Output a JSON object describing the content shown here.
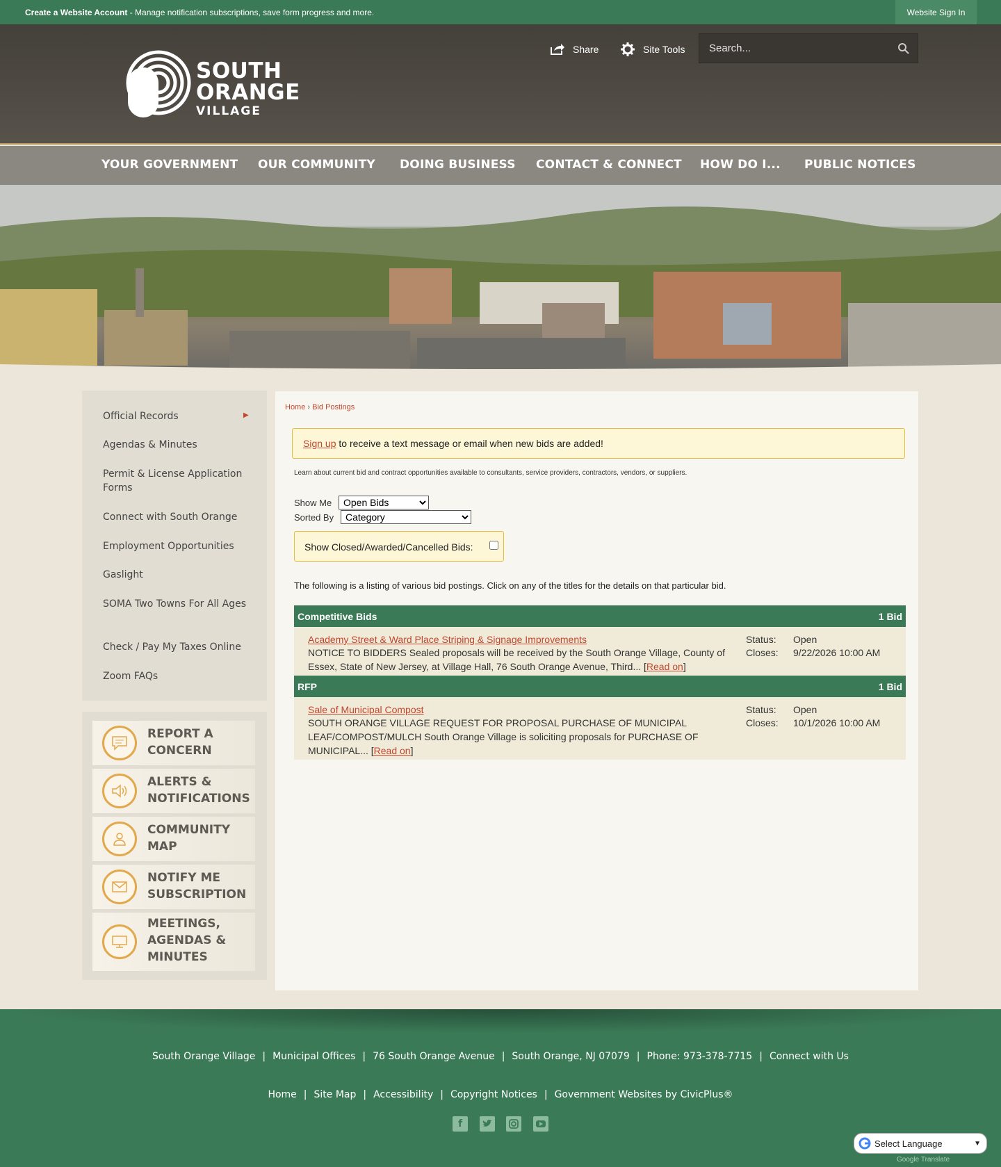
{
  "topbar": {
    "account_link": "Create a Website Account",
    "account_text": " - Manage notification subscriptions, save form progress and more.",
    "signin": "Website Sign In"
  },
  "header": {
    "logo": {
      "line1": "SOUTH",
      "line2": "ORANGE",
      "line3": "VILLAGE"
    },
    "share": "Share",
    "site_tools": "Site Tools",
    "search_placeholder": "Search..."
  },
  "nav": [
    "YOUR GOVERNMENT",
    "OUR COMMUNITY",
    "DOING BUSINESS",
    "CONTACT & CONNECT",
    "HOW DO I...",
    "PUBLIC NOTICES"
  ],
  "sidebar": [
    "Official Records",
    "Agendas & Minutes",
    "Permit & License Application Forms",
    "Connect with South Orange",
    "Employment Opportunities",
    "Gaslight",
    "SOMA Two Towns For All Ages",
    "Check / Pay My Taxes Online",
    "Zoom FAQs"
  ],
  "quicklinks": [
    {
      "label": "Report a Concern",
      "icon": "chat-bubble-icon"
    },
    {
      "label": "Alerts & Notifications",
      "icon": "speaker-icon"
    },
    {
      "label": "Community Map",
      "icon": "person-icon"
    },
    {
      "label": "Notify Me Subscription",
      "icon": "envelope-icon"
    },
    {
      "label": "Meetings, Agendas & Minutes",
      "icon": "monitor-icon"
    }
  ],
  "breadcrumb": {
    "home": "Home",
    "sep": " › ",
    "current": "Bid Postings"
  },
  "alert": {
    "link": "Sign up",
    "text": " to receive a text message or email when new bids are added!"
  },
  "intro": "Learn about current bid and contract opportunities available to consultants, service providers, contractors, vendors, or suppliers.",
  "filters": {
    "show_me_label": "Show Me",
    "show_me_value": "Open Bids",
    "sorted_by_label": "Sorted By",
    "sorted_by_value": "Category",
    "closed_label": "Show Closed/Awarded/Cancelled Bids:"
  },
  "listing_intro": "The following is a listing of various bid postings. Click on any of the titles for the details on that particular bid.",
  "categories": [
    {
      "name": "Competitive Bids",
      "count": "1 Bid",
      "bid": {
        "title": "Academy Street & Ward Place Striping & Signage Improvements",
        "description": "NOTICE TO BIDDERS Sealed proposals will be received by the South Orange Village, County of Essex, State of New Jersey, at Village Hall, 76 South Orange Avenue, Third... ",
        "read_on": "Read on",
        "status_label": "Status:",
        "status": "Open",
        "closes_label": "Closes:",
        "closes": "9/22/2026 10:00 AM"
      }
    },
    {
      "name": "RFP",
      "count": "1 Bid",
      "bid": {
        "title": "Sale of Municipal Compost",
        "description": "SOUTH ORANGE VILLAGE REQUEST FOR PROPOSAL PURCHASE OF MUNICIPAL LEAF/COMPOST/MULCH South Orange Village is soliciting proposals for PURCHASE OF MUNICIPAL... ",
        "read_on": "Read on",
        "status_label": "Status:",
        "status": "Open",
        "closes_label": "Closes:",
        "closes": "10/1/2026 10:00 AM"
      }
    }
  ],
  "footer": {
    "address": [
      "South Orange Village",
      "Municipal Offices",
      "76 South Orange Avenue",
      "South Orange, NJ 07079",
      "Phone: 973-378-7715",
      "Connect with Us"
    ],
    "links": [
      "Home",
      "Site Map",
      "Accessibility",
      "Copyright Notices",
      "Government Websites by CivicPlus®"
    ],
    "separator": "|",
    "social": [
      "facebook-icon",
      "twitter-icon",
      "instagram-icon",
      "youtube-icon"
    ]
  },
  "translate": {
    "label": "Select Language",
    "powered": "Google Translate"
  },
  "colors": {
    "brand_green": "#3b7a57",
    "accent_red": "#c2452e",
    "nav_gray": "#8b8881",
    "header_dark": "#4a4640"
  }
}
